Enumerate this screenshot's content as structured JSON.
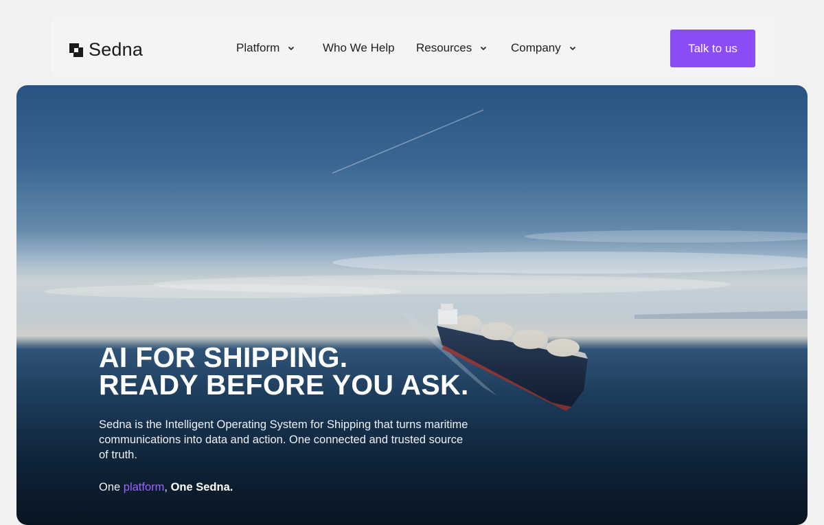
{
  "brand": {
    "name": "Sedna",
    "logo_icon": "sedna-square-logo"
  },
  "nav": {
    "items": [
      {
        "label": "Platform",
        "has_dropdown": true,
        "icon": "chevron-down-icon"
      },
      {
        "label": "Who We Help",
        "has_dropdown": false
      },
      {
        "label": "Resources",
        "has_dropdown": true,
        "icon": "chevron-down-icon"
      },
      {
        "label": "Company",
        "has_dropdown": true,
        "icon": "chevron-down-icon"
      }
    ],
    "cta_label": "Talk to us"
  },
  "hero": {
    "title_line1": "AI FOR SHIPPING.",
    "title_line2": "READY BEFORE YOU ASK.",
    "description": "Sedna is the Intelligent Operating System for Shipping that turns maritime communications into data and action. One connected and trusted source of truth.",
    "tagline": {
      "prefix": "One ",
      "accent": "platform",
      "comma": ",",
      "suffix": " One Sedna."
    },
    "image": "lng-tanker-ship-at-sea"
  },
  "colors": {
    "accent": "#8b4cf7",
    "accent_text": "#9b63ff",
    "page_bg": "#f1f1f1",
    "nav_bg": "#f4f4f4",
    "text_dark": "#1a1a1a",
    "hero_text": "#ffffff"
  }
}
